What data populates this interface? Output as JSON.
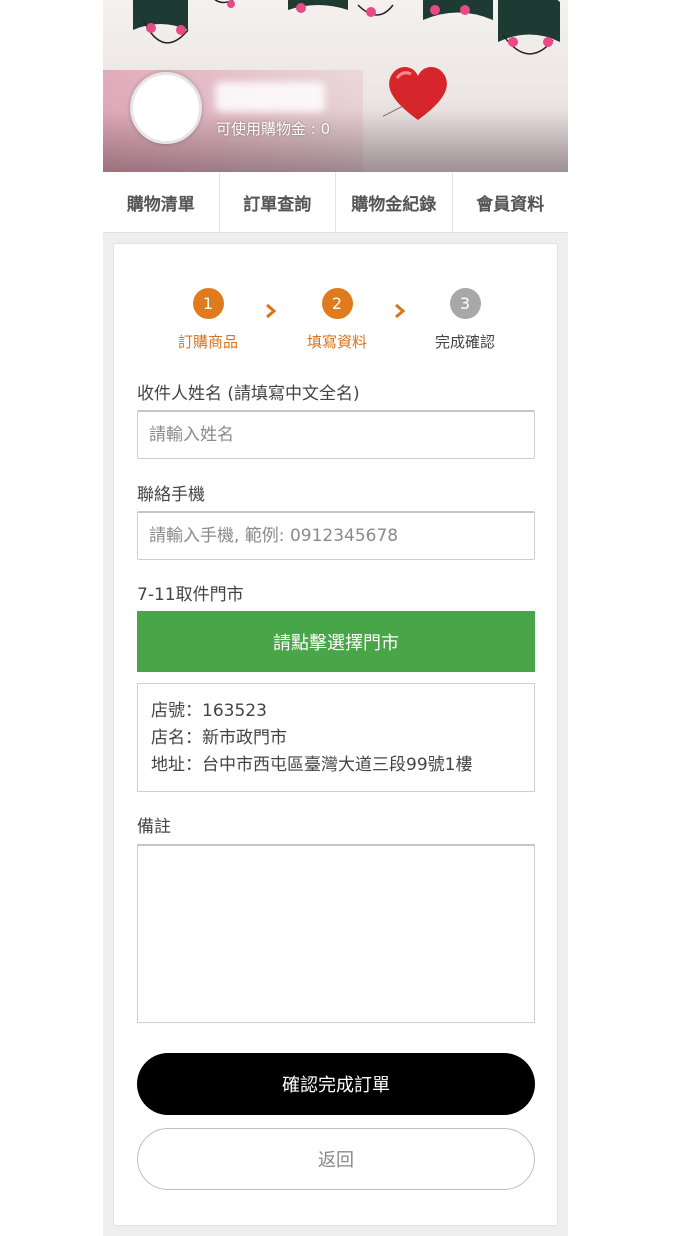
{
  "banner": {
    "credit_text": "可使用購物金 : 0"
  },
  "tabs": [
    {
      "label": "購物清單"
    },
    {
      "label": "訂單查詢"
    },
    {
      "label": "購物金紀錄"
    },
    {
      "label": "會員資料"
    }
  ],
  "steps": [
    {
      "number": "1",
      "label": "訂購商品",
      "state": "active"
    },
    {
      "number": "2",
      "label": "填寫資料",
      "state": "active"
    },
    {
      "number": "3",
      "label": "完成確認",
      "state": "pending"
    }
  ],
  "form": {
    "name_label": "收件人姓名 (請填寫中文全名)",
    "name_placeholder": "請輸入姓名",
    "phone_label": "聯絡手機",
    "phone_placeholder": "請輸入手機, 範例: 0912345678",
    "store_label": "7-11取件門市",
    "store_button": "請點擊選擇門市",
    "store_info": {
      "number": "店號：163523",
      "name": "店名：新市政門市",
      "address": "地址：台中市西屯區臺灣大道三段99號1樓"
    },
    "note_label": "備註",
    "confirm_button": "確認完成訂單",
    "back_button": "返回"
  },
  "colors": {
    "step_active": "#e07a1f",
    "step_pending": "#a8a8a8",
    "store_button": "#48a548",
    "confirm_button": "#000000"
  }
}
